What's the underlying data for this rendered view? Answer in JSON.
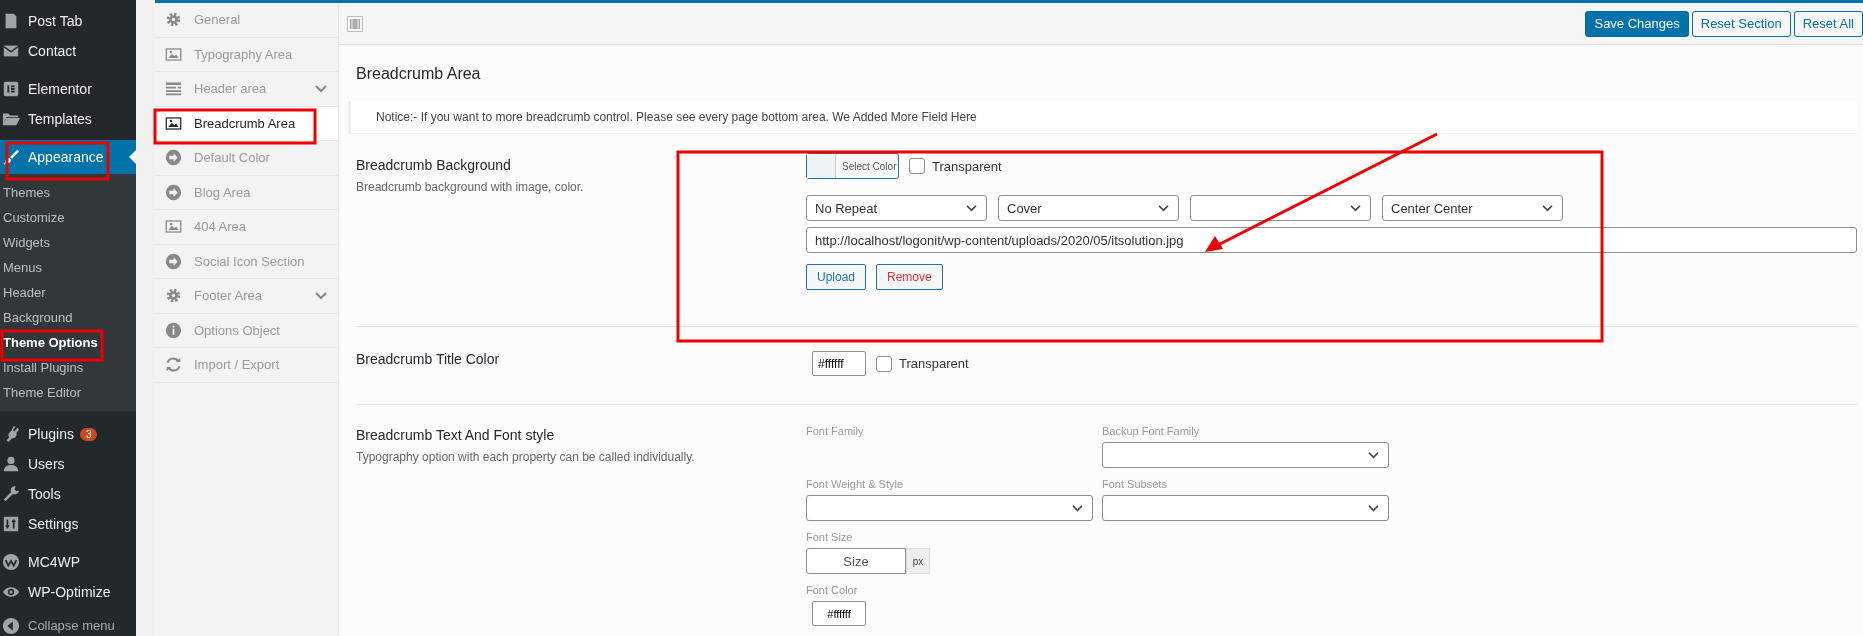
{
  "admin_menu": {
    "groups": [
      {
        "items": [
          {
            "label": "Post Tab",
            "current": false
          },
          {
            "label": "Contact",
            "current": false
          }
        ]
      },
      {
        "items": [
          {
            "label": "Elementor",
            "current": false
          },
          {
            "label": "Templates",
            "current": false
          },
          {
            "label": "Appearance",
            "current": true,
            "submenu": [
              {
                "label": "Themes",
                "selected": false
              },
              {
                "label": "Customize",
                "selected": false
              },
              {
                "label": "Widgets",
                "selected": false
              },
              {
                "label": "Menus",
                "selected": false
              },
              {
                "label": "Header",
                "selected": false
              },
              {
                "label": "Background",
                "selected": false
              },
              {
                "label": "Theme Options",
                "selected": true
              },
              {
                "label": "Install Plugins",
                "selected": false
              },
              {
                "label": "Theme Editor",
                "selected": false
              }
            ]
          }
        ]
      },
      {
        "items": [
          {
            "label": "Plugins",
            "current": false,
            "badge": "3"
          },
          {
            "label": "Users",
            "current": false
          },
          {
            "label": "Tools",
            "current": false
          },
          {
            "label": "Settings",
            "current": false
          }
        ]
      },
      {
        "items": [
          {
            "label": "MC4WP",
            "current": false
          },
          {
            "label": "WP-Optimize",
            "current": false
          }
        ]
      }
    ],
    "collapse": "Collapse menu"
  },
  "options_menu": {
    "items": [
      {
        "label": "General",
        "selected": false,
        "has_submenu": false
      },
      {
        "label": "Typography Area",
        "selected": false,
        "has_submenu": false
      },
      {
        "label": "Header area",
        "selected": false,
        "has_submenu": true
      },
      {
        "label": "Breadcrumb Area",
        "selected": true,
        "has_submenu": false
      },
      {
        "label": "Default Color",
        "selected": false,
        "has_submenu": false
      },
      {
        "label": "Blog Area",
        "selected": false,
        "has_submenu": false
      },
      {
        "label": "404 Area",
        "selected": false,
        "has_submenu": false
      },
      {
        "label": "Social Icon Section",
        "selected": false,
        "has_submenu": false
      },
      {
        "label": "Footer Area",
        "selected": false,
        "has_submenu": true
      },
      {
        "label": "Options Object",
        "selected": false,
        "has_submenu": false
      },
      {
        "label": "Import / Export",
        "selected": false,
        "has_submenu": false
      }
    ]
  },
  "toolbar": {
    "buttons": [
      {
        "label": "Save Changes",
        "primary": true
      },
      {
        "label": "Reset Section",
        "primary": false
      },
      {
        "label": "Reset All",
        "primary": false
      }
    ]
  },
  "panel": {
    "title": "Breadcrumb Area",
    "notice": "Notice:- If you want to more breadcrumb control. Please see every page bottom area. We Added More Field Here",
    "fields": [
      {
        "kind": "background",
        "title": "Breadcrumb Background",
        "description": "Breadcrumb background with image, color.",
        "color_button": "Select Color",
        "transparent": {
          "label": "Transparent",
          "checked": false
        },
        "selects": [
          {
            "kind": "dropdown",
            "value": "No Repeat"
          },
          {
            "kind": "dropdown",
            "value": "Cover"
          },
          {
            "kind": "dropdown"
          },
          {
            "kind": "dropdown",
            "value": "Center Center"
          }
        ],
        "url": "http://localhost/logonit/wp-content/uploads/2020/05/itsolution.jpg",
        "buttons": [
          {
            "label": "Upload",
            "danger": false
          },
          {
            "label": "Remove",
            "danger": true
          }
        ]
      },
      {
        "kind": "color",
        "title": "Breadcrumb Title Color",
        "value": "#ffffff",
        "transparent": {
          "label": "Transparent",
          "checked": false
        }
      },
      {
        "kind": "typography",
        "title": "Breadcrumb Text And Font style",
        "description": "Typography option with each property can be called individually.",
        "font_family": {
          "label": "Font Family"
        },
        "backup_font_family": {
          "label": "Backup Font Family"
        },
        "font_weight_style": {
          "label": "Font Weight & Style"
        },
        "font_subsets": {
          "label": "Font Subsets"
        },
        "font_size": {
          "label": "Font Size",
          "placeholder": "Size",
          "unit": "px"
        },
        "font_color": {
          "label": "Font Color",
          "value": "#ffffff"
        }
      }
    ]
  }
}
